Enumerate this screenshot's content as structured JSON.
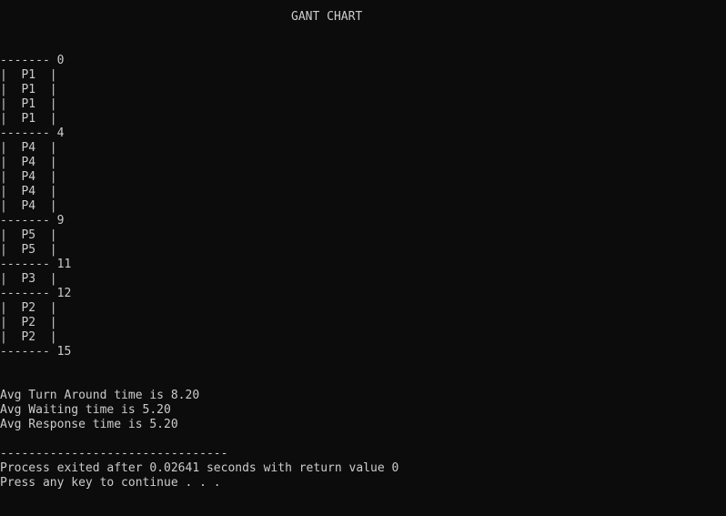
{
  "title": "GANT CHART",
  "gantt": [
    {
      "kind": "sep",
      "text": "------- 0"
    },
    {
      "kind": "row",
      "text": "|  P1  |"
    },
    {
      "kind": "row",
      "text": "|  P1  |"
    },
    {
      "kind": "row",
      "text": "|  P1  |"
    },
    {
      "kind": "row",
      "text": "|  P1  |"
    },
    {
      "kind": "sep",
      "text": "------- 4"
    },
    {
      "kind": "row",
      "text": "|  P4  |"
    },
    {
      "kind": "row",
      "text": "|  P4  |"
    },
    {
      "kind": "row",
      "text": "|  P4  |"
    },
    {
      "kind": "row",
      "text": "|  P4  |"
    },
    {
      "kind": "row",
      "text": "|  P4  |"
    },
    {
      "kind": "sep",
      "text": "------- 9"
    },
    {
      "kind": "row",
      "text": "|  P5  |"
    },
    {
      "kind": "row",
      "text": "|  P5  |"
    },
    {
      "kind": "sep",
      "text": "------- 11"
    },
    {
      "kind": "row",
      "text": "|  P3  |"
    },
    {
      "kind": "sep",
      "text": "------- 12"
    },
    {
      "kind": "row",
      "text": "|  P2  |"
    },
    {
      "kind": "row",
      "text": "|  P2  |"
    },
    {
      "kind": "row",
      "text": "|  P2  |"
    },
    {
      "kind": "sep",
      "text": "------- 15"
    }
  ],
  "stats": [
    "Avg Turn Around time is 8.20",
    "Avg Waiting time is 5.20",
    "Avg Response time is 5.20"
  ],
  "footer": {
    "divider": "--------------------------------",
    "exit": "Process exited after 0.02641 seconds with return value 0",
    "prompt": "Press any key to continue . . ."
  },
  "colors": {
    "background": "#0c0c0c",
    "text": "#cccccc"
  }
}
